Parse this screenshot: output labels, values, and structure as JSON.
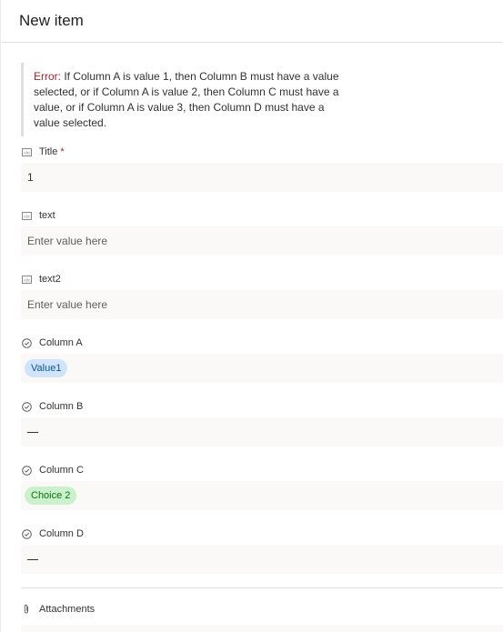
{
  "header": {
    "title": "New item"
  },
  "error": {
    "label": "Error:",
    "message": " If Column A is value 1, then Column B must have a value selected, or if Column A is value 2, then Column C must have a value, or if Column A is value 3, then Column D must have a value selected."
  },
  "fields": {
    "title": {
      "label": "Title",
      "required_mark": "*",
      "value": "1",
      "icon": "text-field-icon"
    },
    "text": {
      "label": "text",
      "placeholder": "Enter value here",
      "icon": "text-field-icon"
    },
    "text2": {
      "label": "text2",
      "placeholder": "Enter value here",
      "icon": "text-field-icon"
    },
    "column_a": {
      "label": "Column A",
      "value": "Value1",
      "icon": "choice-field-icon",
      "pill_color": "#cfe4fa"
    },
    "column_b": {
      "label": "Column B",
      "value": "",
      "icon": "choice-field-icon"
    },
    "column_c": {
      "label": "Column C",
      "value": "Choice 2",
      "icon": "choice-field-icon",
      "pill_color": "#caf0cc"
    },
    "column_d": {
      "label": "Column D",
      "value": "",
      "icon": "choice-field-icon"
    }
  },
  "attachments": {
    "label": "Attachments",
    "icon": "paperclip-icon"
  },
  "colors": {
    "error_text": "#a4262c",
    "field_background": "#faf9f8",
    "divider": "#e1dfdd"
  }
}
